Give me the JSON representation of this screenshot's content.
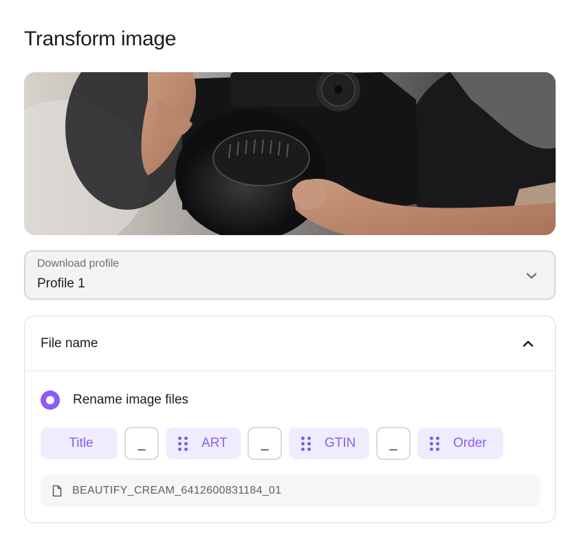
{
  "page": {
    "title": "Transform image"
  },
  "hero": {
    "icon": "camera-photo"
  },
  "download_profile": {
    "label": "Download profile",
    "value": "Profile 1",
    "icon": "chevron-down-icon"
  },
  "file_name": {
    "title": "File name",
    "icon": "chevron-up-icon",
    "rename_option": {
      "label": "Rename image files",
      "selected": true
    },
    "tokens": {
      "title": "Title",
      "sep1": "_",
      "art": "ART",
      "sep2": "_",
      "gtin": "GTIN",
      "sep3": "_",
      "order": "Order"
    },
    "preview": "BEAUTIFY_CREAM_6412600831184_01"
  },
  "colors": {
    "accent": "#8b5cf6",
    "chip_bg": "#efedfd",
    "border": "#d6d6da"
  }
}
